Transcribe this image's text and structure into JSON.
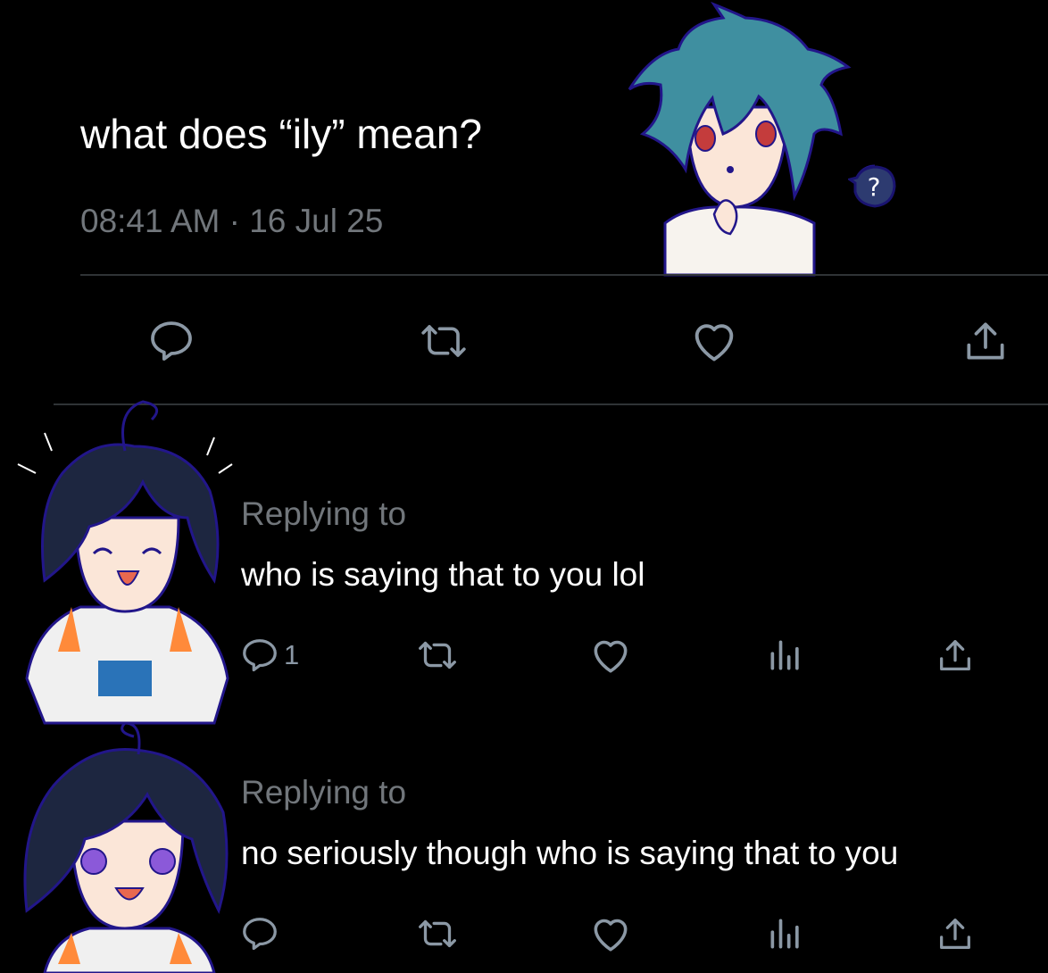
{
  "post": {
    "text": "what does “ily” mean?",
    "timestamp": "08:41 AM · 16 Jul 25"
  },
  "replies": [
    {
      "replying_label": "Replying to",
      "text": "who is saying that to you lol",
      "reply_count": "1"
    },
    {
      "replying_label": "Replying to",
      "text": "no seriously though who is saying that to you",
      "reply_count": ""
    }
  ],
  "icons": [
    "reply-icon",
    "repost-icon",
    "like-icon",
    "views-icon",
    "share-icon",
    "question-bubble-icon"
  ],
  "colors": {
    "background": "#000000",
    "text": "#ffffff",
    "muted": "#71767b",
    "divider": "#2f3336",
    "icon": "#8b98a5"
  }
}
